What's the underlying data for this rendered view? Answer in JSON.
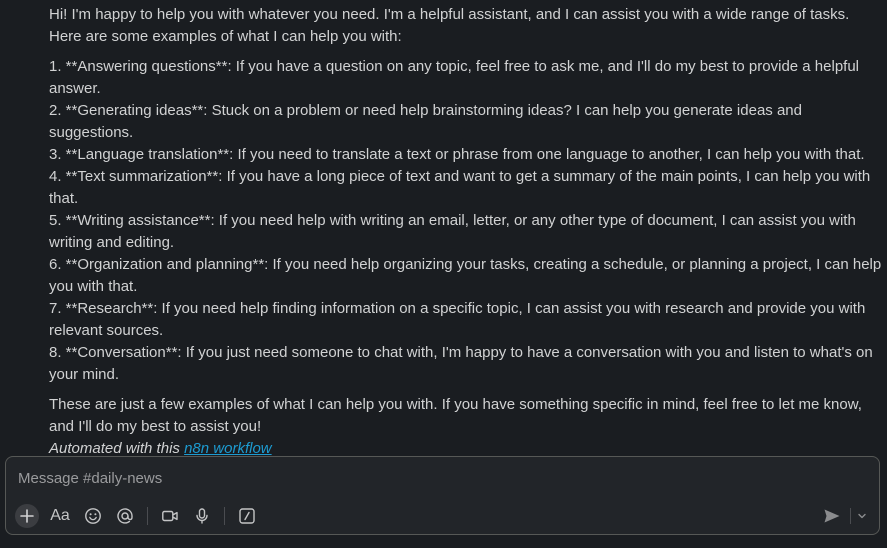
{
  "message": {
    "intro": "Hi! I'm happy to help you with whatever you need. I'm a helpful assistant, and I can assist you with a wide range of tasks. Here are some examples of what I can help you with:",
    "items": [
      "1. **Answering questions**: If you have a question on any topic, feel free to ask me, and I'll do my best to provide a helpful answer.",
      "2. **Generating ideas**: Stuck on a problem or need help brainstorming ideas? I can help you generate ideas and suggestions.",
      "3. **Language translation**: If you need to translate a text or phrase from one language to another, I can help you with that.",
      "4. **Text summarization**: If you have a long piece of text and want to get a summary of the main points, I can help you with that.",
      "5. **Writing assistance**: If you need help with writing an email, letter, or any other type of document, I can assist you with writing and editing.",
      "6. **Organization and planning**: If you need help organizing your tasks, creating a schedule, or planning a project, I can help you with that.",
      "7. **Research**: If you need help finding information on a specific topic, I can assist you with research and provide you with relevant sources.",
      "8. **Conversation**: If you just need someone to chat with, I'm happy to have a conversation with you and listen to what's on your mind."
    ],
    "closing": "These are just a few examples of what I can help you with. If you have something specific in mind, feel free to let me know, and I'll do my best to assist you!",
    "footer_prefix": "Automated with this ",
    "footer_link": "n8n workflow"
  },
  "composer": {
    "placeholder": "Message #daily-news",
    "value": "",
    "toolbar": {
      "formatting_label": "Aa",
      "icons": [
        "plus-icon",
        "formatting-icon",
        "emoji-icon",
        "mention-icon",
        "video-icon",
        "microphone-icon",
        "shortcuts-icon"
      ]
    },
    "send_icon": "send-icon",
    "send_options_icon": "chevron-down-icon"
  },
  "colors": {
    "background": "#1a1d21",
    "text": "#d1d2d3",
    "link": "#1d9bd1",
    "composer_border": "#565856",
    "composer_bg": "#222529"
  }
}
